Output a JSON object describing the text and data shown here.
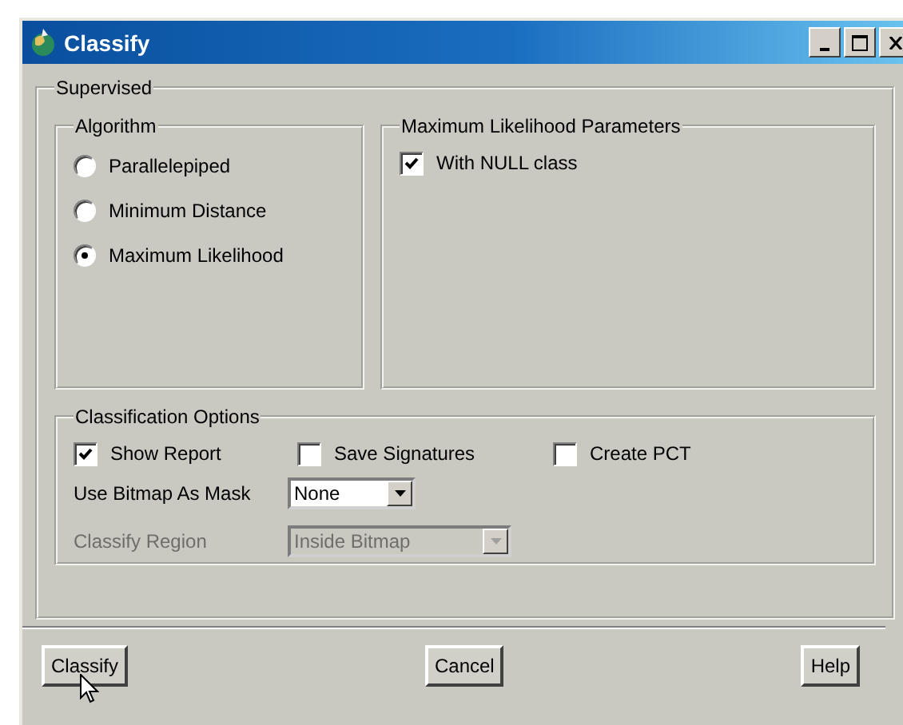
{
  "window": {
    "title": "Classify"
  },
  "supervised": {
    "title": "Supervised",
    "algorithm": {
      "title": "Algorithm",
      "options": [
        {
          "label": "Parallelepiped",
          "selected": false
        },
        {
          "label": "Minimum Distance",
          "selected": false
        },
        {
          "label": "Maximum Likelihood",
          "selected": true
        }
      ]
    },
    "ml_parameters": {
      "title": "Maximum Likelihood Parameters",
      "with_null_class": {
        "label": "With NULL class",
        "checked": true
      }
    },
    "classification_options": {
      "title": "Classification Options",
      "checkboxes": [
        {
          "label": "Show Report",
          "checked": true
        },
        {
          "label": "Save Signatures",
          "checked": false
        },
        {
          "label": "Create PCT",
          "checked": false
        }
      ],
      "mask": {
        "label": "Use Bitmap As Mask",
        "value": "None",
        "disabled": false
      },
      "region": {
        "label": "Classify Region",
        "value": "Inside Bitmap",
        "disabled": true
      }
    }
  },
  "buttons": [
    "Classify",
    "Cancel",
    "Help"
  ]
}
